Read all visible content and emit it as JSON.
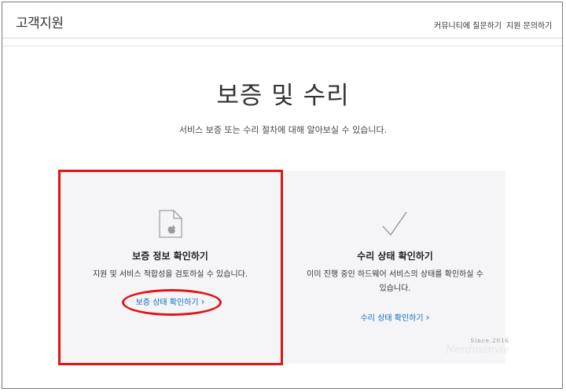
{
  "header": {
    "brand": "고객지원",
    "links": [
      "커뮤니티에 질문하기",
      "지원 문의하기"
    ]
  },
  "hero": {
    "title": "보증 및 수리",
    "subtitle": "서비스 보증 또는 수리 절차에 대해 알아보실 수 있습니다."
  },
  "cards": [
    {
      "icon": "document-apple-icon",
      "title": "보증 정보 확인하기",
      "text": "지원 및 서비스 적합성을 검토하실 수 있습니다.",
      "link": "보증 상태 확인하기"
    },
    {
      "icon": "checkmark-icon",
      "title": "수리 상태 확인하기",
      "text_line1": "이미 진행 중인 하드웨어 서비스의 상태를 확인하실 수",
      "text_line2": "있습니다.",
      "link": "수리 상태 확인하기"
    }
  ],
  "watermark": {
    "small": "Since.2016",
    "big": "Nerdmanvie"
  },
  "colors": {
    "link": "#0a6cc4",
    "highlight": "#e01515",
    "card_bg": "#f5f5f7"
  }
}
